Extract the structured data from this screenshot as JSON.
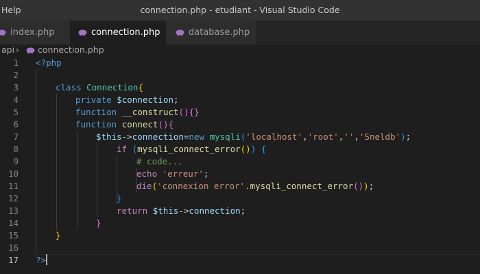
{
  "titlebar": {
    "menu": "Help",
    "title": "connection.php - etudiant - Visual Studio Code"
  },
  "tabs": [
    {
      "label": "index.php",
      "icon": "php-elephant-icon"
    },
    {
      "label": "connection.php",
      "icon": "php-elephant-icon",
      "active": true,
      "close": "×"
    },
    {
      "label": "database.php",
      "icon": "php-elephant-icon"
    }
  ],
  "breadcrumb": {
    "folder": "api",
    "separator": "›",
    "file": "connection.php"
  },
  "editor": {
    "line_numbers": [
      "1",
      "2",
      "3",
      "4",
      "5",
      "6",
      "7",
      "8",
      "9",
      "10",
      "11",
      "12",
      "13",
      "14",
      "15",
      "16",
      "17"
    ],
    "current_line": "17",
    "lines": [
      [
        [
          "kw",
          "<?php"
        ]
      ],
      [],
      [
        [
          "kw",
          "class"
        ],
        [
          "pl",
          " "
        ],
        [
          "cls",
          "Connection"
        ],
        [
          "b1",
          "{"
        ]
      ],
      [
        [
          "kw",
          "private"
        ],
        [
          "pl",
          " "
        ],
        [
          "var",
          "$connection"
        ],
        [
          "pl",
          ";"
        ]
      ],
      [
        [
          "kw",
          "function"
        ],
        [
          "pl",
          " "
        ],
        [
          "fn",
          "__construct"
        ],
        [
          "b2",
          "()"
        ],
        [
          "b2",
          "{}"
        ]
      ],
      [
        [
          "kw",
          "function"
        ],
        [
          "pl",
          " "
        ],
        [
          "fn",
          "connect"
        ],
        [
          "b2",
          "()"
        ],
        [
          "b2",
          "{"
        ]
      ],
      [
        [
          "var",
          "$this"
        ],
        [
          "pl",
          "->"
        ],
        [
          "var",
          "connection"
        ],
        [
          "pl",
          "="
        ],
        [
          "kw",
          "new"
        ],
        [
          "pl",
          " "
        ],
        [
          "cls",
          "mysqli"
        ],
        [
          "b3",
          "("
        ],
        [
          "str",
          "'localhost'"
        ],
        [
          "pl",
          ","
        ],
        [
          "str",
          "'root'"
        ],
        [
          "pl",
          ","
        ],
        [
          "str",
          "''"
        ],
        [
          "pl",
          ","
        ],
        [
          "str",
          "'Sneldb'"
        ],
        [
          "b3",
          ")"
        ],
        [
          "pl",
          ";"
        ]
      ],
      [
        [
          "ctrl",
          "if"
        ],
        [
          "pl",
          " "
        ],
        [
          "b3",
          "("
        ],
        [
          "fn",
          "mysqli_connect_error"
        ],
        [
          "b1",
          "()"
        ],
        [
          "b3",
          ")"
        ],
        [
          "pl",
          " "
        ],
        [
          "b3",
          "{"
        ]
      ],
      [
        [
          "cmt",
          "# code..."
        ]
      ],
      [
        [
          "ctrl",
          "echo"
        ],
        [
          "pl",
          " "
        ],
        [
          "str",
          "'erreur'"
        ],
        [
          "pl",
          ";"
        ]
      ],
      [
        [
          "ctrl",
          "die"
        ],
        [
          "b1",
          "("
        ],
        [
          "str",
          "'connexion error'"
        ],
        [
          "pl",
          "."
        ],
        [
          "fn",
          "mysqli_connect_error"
        ],
        [
          "b2",
          "()"
        ],
        [
          "b1",
          ")"
        ],
        [
          "pl",
          ";"
        ]
      ],
      [
        [
          "b3",
          "}"
        ]
      ],
      [
        [
          "ctrl",
          "return"
        ],
        [
          "pl",
          " "
        ],
        [
          "var",
          "$this"
        ],
        [
          "pl",
          "->"
        ],
        [
          "var",
          "connection"
        ],
        [
          "pl",
          ";"
        ]
      ],
      [
        [
          "b2",
          "}"
        ]
      ],
      [
        [
          "b1",
          "}"
        ]
      ],
      [],
      [
        [
          "kw",
          "?>"
        ]
      ]
    ]
  }
}
